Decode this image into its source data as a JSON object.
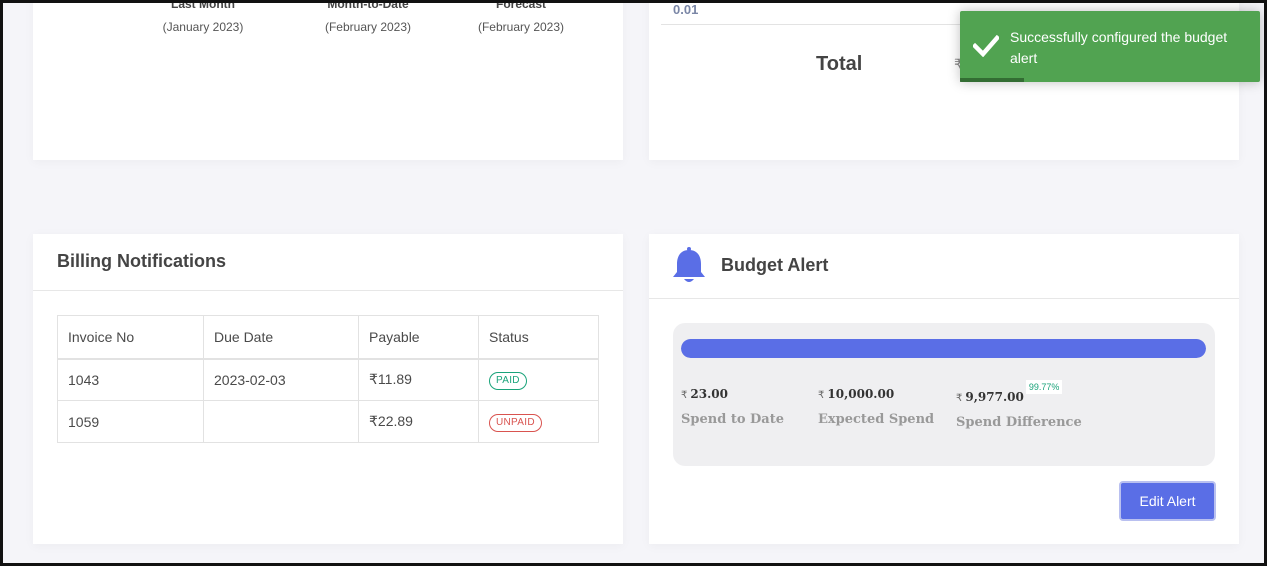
{
  "spend_summary": {
    "columns": [
      {
        "title": "Last Month",
        "subtitle": "(January 2023)"
      },
      {
        "title": "Month-to-Date",
        "subtitle": "(February 2023)"
      },
      {
        "title": "Forecast",
        "subtitle": "(February 2023)"
      }
    ]
  },
  "total_card": {
    "top_value": "0.01",
    "label": "Total",
    "currency_glyph": "₹"
  },
  "toast": {
    "message": "Successfully configured the budget alert",
    "icon": "checkmark-icon",
    "color": "#51a351"
  },
  "billing": {
    "title": "Billing Notifications",
    "headers": [
      "Invoice No",
      "Due Date",
      "Payable",
      "Status"
    ],
    "rows": [
      {
        "invoice": "1043",
        "due_date": "2023-02-03",
        "payable": "₹11.89",
        "status": "PAID"
      },
      {
        "invoice": "1059",
        "due_date": "",
        "payable": "₹22.89",
        "status": "UNPAID"
      }
    ]
  },
  "budget_alert": {
    "title": "Budget Alert",
    "icon": "bell-icon",
    "accent_color": "#5a6ee6",
    "progress": 1.0,
    "spend_to_date": {
      "currency": "₹",
      "value": "23.00",
      "label": "Spend to Date"
    },
    "expected_spend": {
      "currency": "₹",
      "value": "10,000.00",
      "label": "Expected Spend"
    },
    "spend_difference": {
      "currency": "₹",
      "value": "9,977.00",
      "percent": "99.77%",
      "label": "Spend Difference"
    },
    "edit_button": "Edit Alert"
  }
}
